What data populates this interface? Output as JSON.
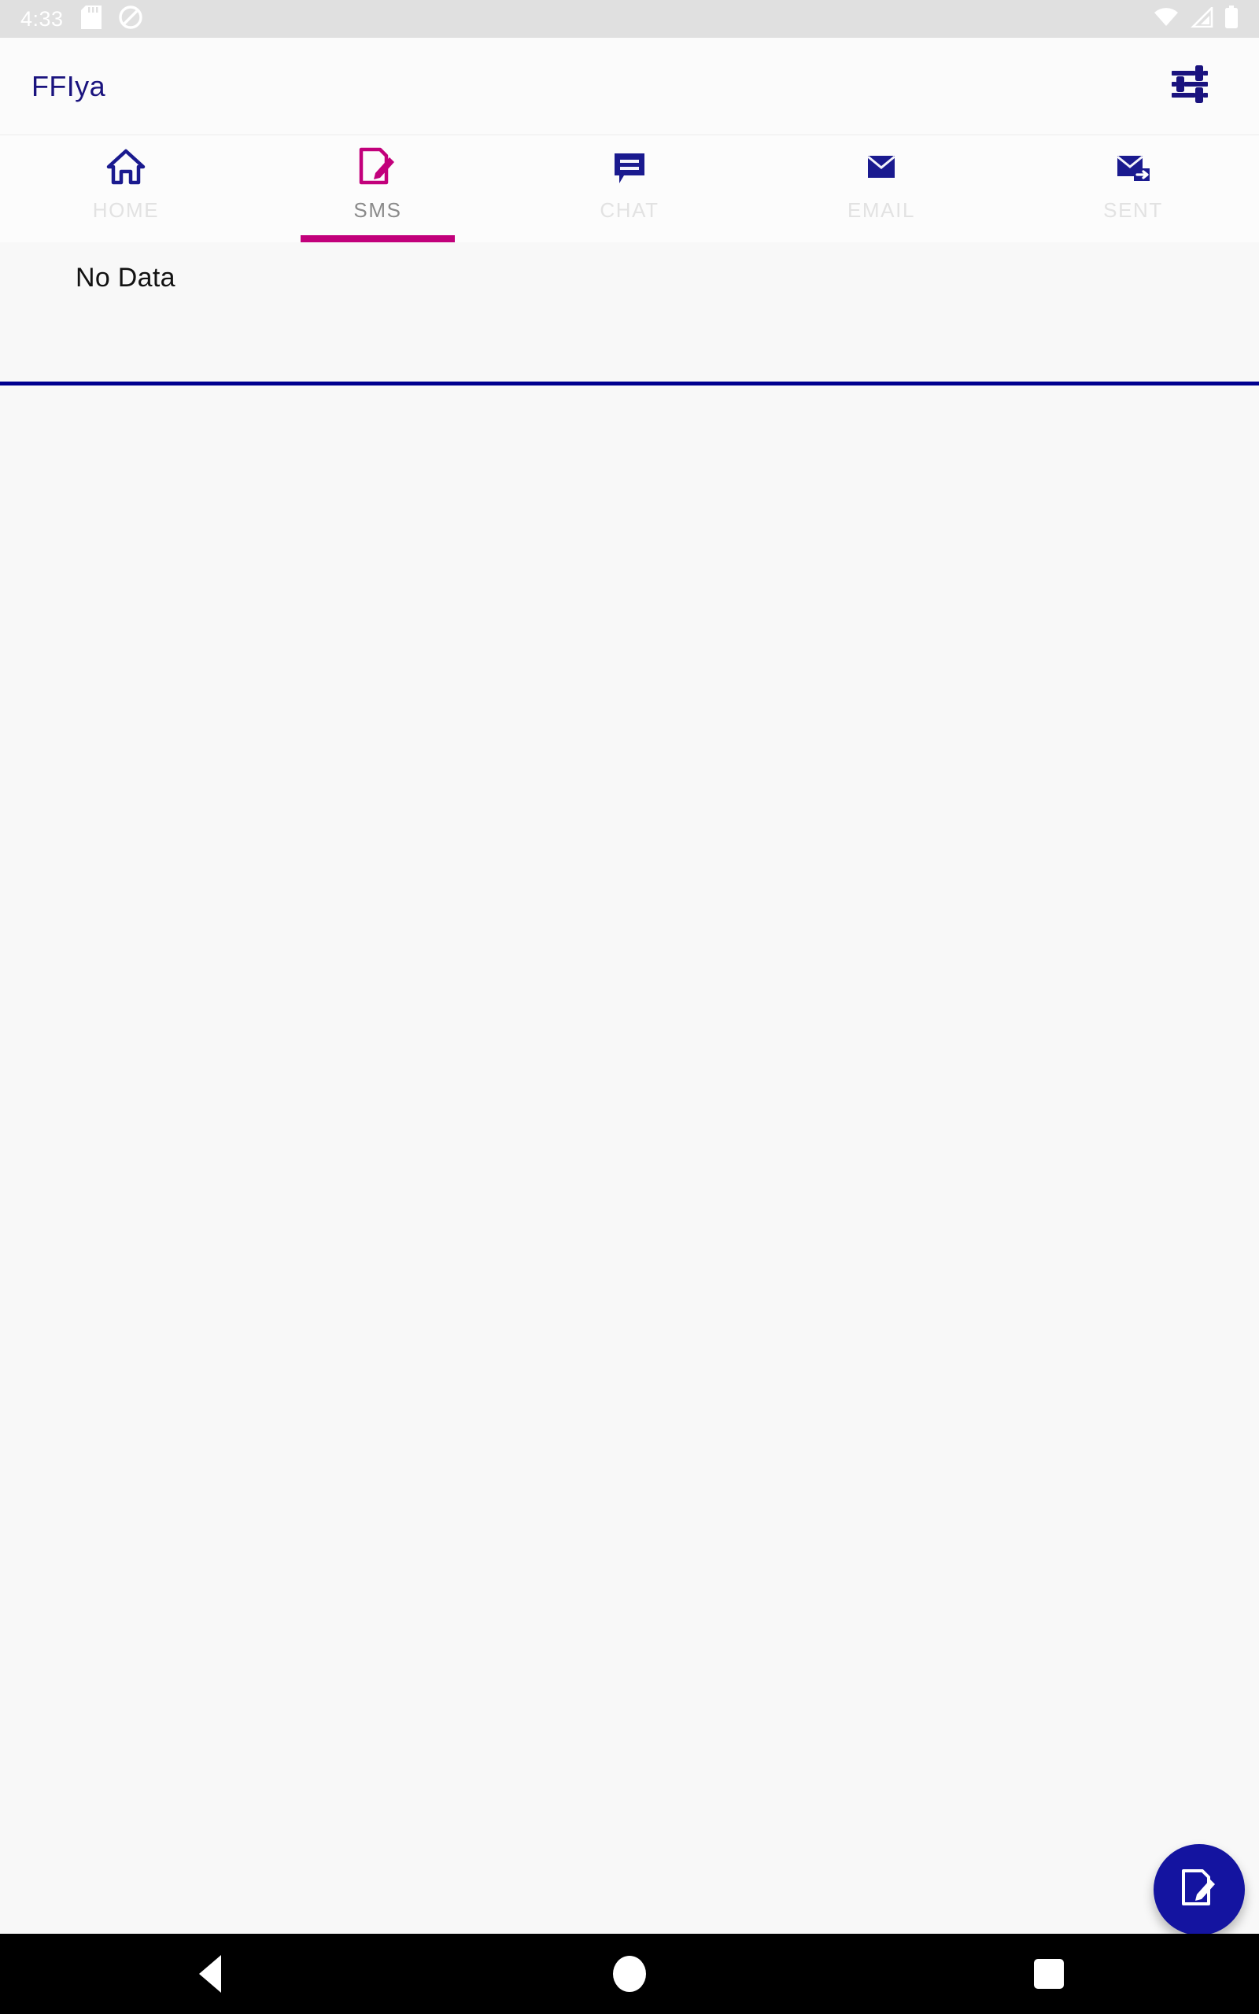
{
  "status_bar": {
    "time": "4:33",
    "left_icons": [
      "sd-card-icon",
      "dnd-icon"
    ],
    "right_icons": [
      "wifi-icon",
      "cell-signal-icon",
      "battery-icon"
    ],
    "background": "#e0e0e0",
    "icon_color": "#ffffff"
  },
  "app_bar": {
    "title": "FFIya",
    "title_color": "#1a137e",
    "action_icon": "tune-sliders-icon",
    "action_icon_color": "#1a137e"
  },
  "tabs": {
    "active_index": 1,
    "indicator_color": "#c2007b",
    "active_label_color": "#8a8a8a",
    "inactive_label_color": "#e2e2e2",
    "items": [
      {
        "label": "HOME",
        "icon": "home-icon",
        "icon_color": "#1a1a8f",
        "active": false
      },
      {
        "label": "SMS",
        "icon": "compose-message-icon",
        "icon_color": "#c2007b",
        "active": true
      },
      {
        "label": "CHAT",
        "icon": "chat-bubble-icon",
        "icon_color": "#1a1a8f",
        "active": false
      },
      {
        "label": "EMAIL",
        "icon": "envelope-icon",
        "icon_color": "#1a1a8f",
        "active": false
      },
      {
        "label": "SENT",
        "icon": "envelope-sent-icon",
        "icon_color": "#1a1a8f",
        "active": false
      }
    ]
  },
  "content": {
    "empty_message": "No Data",
    "empty_message_color": "#121212",
    "divider_color": "#00008f",
    "background": "#f8f8f8"
  },
  "fab": {
    "icon": "compose-document-icon",
    "background": "#1414a0",
    "icon_color": "#ffffff"
  },
  "nav_bar": {
    "background": "#000000",
    "buttons": [
      "back-button",
      "home-button",
      "recents-button"
    ]
  }
}
